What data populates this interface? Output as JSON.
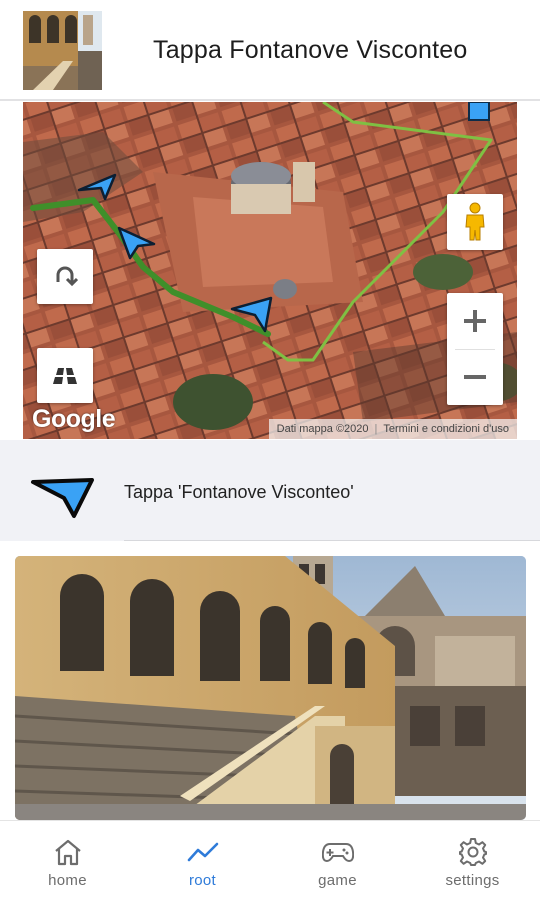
{
  "header": {
    "title": "Tappa Fontanove Visconteo",
    "thumbnail_icon": "stage-photo-thumbnail"
  },
  "map": {
    "logo": "Google",
    "attribution_data": "Dati mappa ©2020",
    "attribution_separator": "|",
    "attribution_terms": "Termini e condizioni d'uso",
    "controls": {
      "rotate_icon": "rotate-icon",
      "tilt_icon": "tilt-icon",
      "pegman_icon": "pegman-icon",
      "zoom_in": "+",
      "zoom_out": "−"
    },
    "route_colors": {
      "walked": "#3f8f2a",
      "planned": "#7fc043"
    },
    "marker_color": "#3aa2f5"
  },
  "stage": {
    "label": "Tappa 'Fontanove Visconteo'",
    "icon": "navigation-arrow-icon"
  },
  "photo": {
    "icon": "stage-photo"
  },
  "nav": {
    "items": [
      {
        "label": "home",
        "icon": "home-icon",
        "active": false
      },
      {
        "label": "root",
        "icon": "route-chart-icon",
        "active": true
      },
      {
        "label": "game",
        "icon": "gamepad-icon",
        "active": false
      },
      {
        "label": "settings",
        "icon": "gear-icon",
        "active": false
      }
    ],
    "active_color": "#2f7bd9",
    "inactive_color": "#6d6d6d"
  }
}
